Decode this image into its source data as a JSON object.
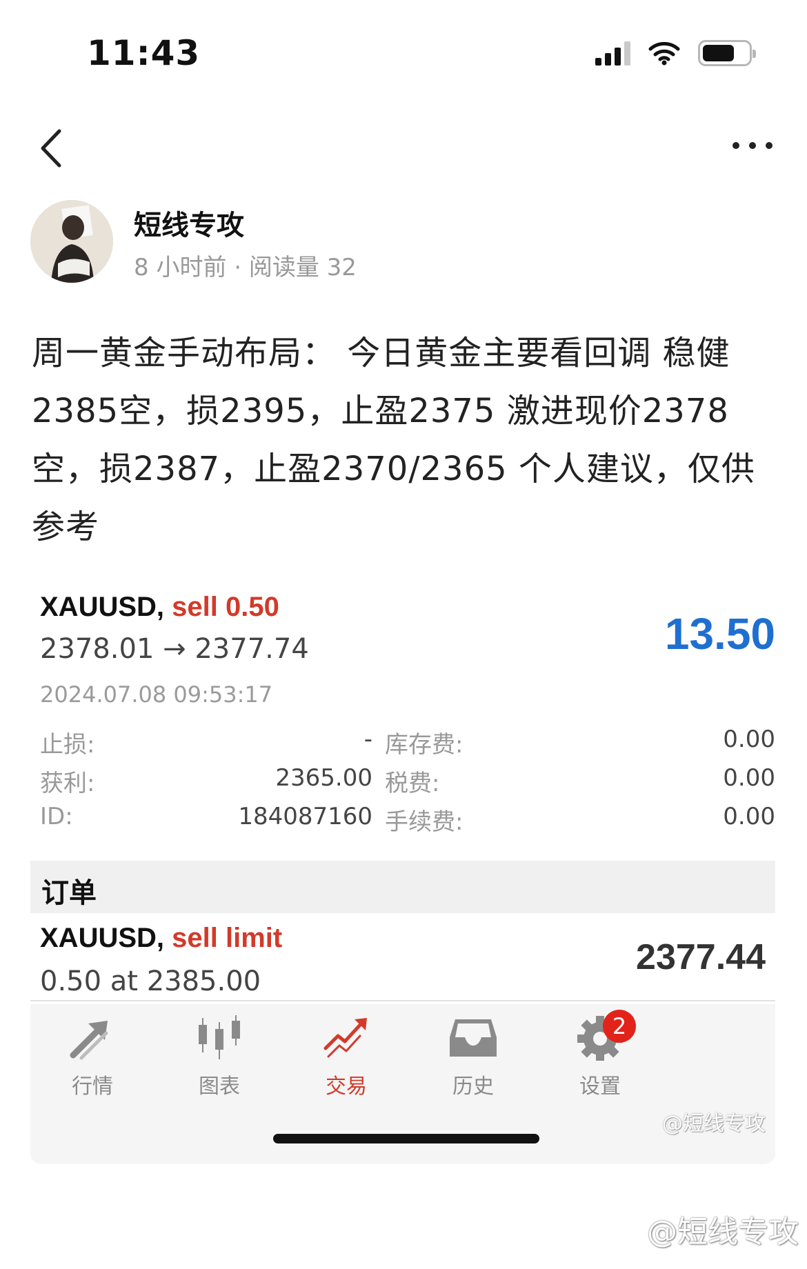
{
  "status_bar": {
    "time": "11:43"
  },
  "author": {
    "name": "短线专攻",
    "meta": "8 小时前 · 阅读量 32"
  },
  "post": {
    "text": "周一黄金手动布局： 今日黄金主要看回调 稳健2385空，损2395，止盈2375 激进现价2378空，损2387，止盈2370/2365 个人建议，仅供参考"
  },
  "trade": {
    "symbol": "XAUUSD,",
    "side": "sell 0.50",
    "prices": "2378.01 → 2377.74",
    "profit": "13.50",
    "datetime": "2024.07.08 09:53:17",
    "details": [
      {
        "label": "止损:",
        "value": "-",
        "label2": "库存费:",
        "value2": "0.00"
      },
      {
        "label": "获利:",
        "value": "2365.00",
        "label2": "税费:",
        "value2": "0.00"
      },
      {
        "label": "ID:",
        "value": "184087160",
        "label2": "手续费:",
        "value2": "0.00"
      }
    ]
  },
  "orders": {
    "title": "订单",
    "item": {
      "symbol": "XAUUSD,",
      "type": "sell limit",
      "desc": "0.50 at 2385.00",
      "price": "2377.44"
    }
  },
  "tabbar": {
    "tabs": [
      {
        "label": "行情",
        "icon": "quotes-arrows-icon"
      },
      {
        "label": "图表",
        "icon": "candlestick-chart-icon"
      },
      {
        "label": "交易",
        "icon": "trade-trend-icon",
        "active": true
      },
      {
        "label": "历史",
        "icon": "history-inbox-icon"
      },
      {
        "label": "设置",
        "icon": "settings-gear-icon",
        "badge": "2"
      }
    ]
  },
  "watermark": {
    "small": "@短线专攻",
    "large": "@短线专攻"
  },
  "colors": {
    "sell_red": "#d23a2a",
    "profit_blue": "#1f6fd1",
    "badge_red": "#e2231a"
  }
}
